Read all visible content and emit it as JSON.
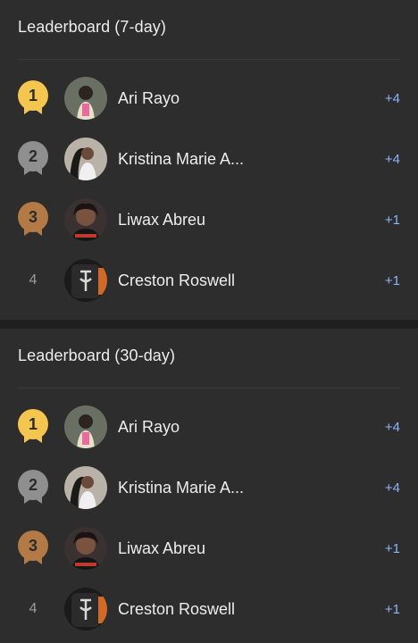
{
  "leaderboards": [
    {
      "title": "Leaderboard (7-day)",
      "entries": [
        {
          "rank": "1",
          "medal": "gold",
          "name": "Ari Rayo",
          "score": "+4"
        },
        {
          "rank": "2",
          "medal": "silver",
          "name": "Kristina Marie A...",
          "score": "+4"
        },
        {
          "rank": "3",
          "medal": "bronze",
          "name": "Liwax Abreu",
          "score": "+1"
        },
        {
          "rank": "4",
          "medal": "none",
          "name": "Creston Roswell",
          "score": "+1"
        }
      ]
    },
    {
      "title": "Leaderboard (30-day)",
      "entries": [
        {
          "rank": "1",
          "medal": "gold",
          "name": "Ari Rayo",
          "score": "+4"
        },
        {
          "rank": "2",
          "medal": "silver",
          "name": "Kristina Marie A...",
          "score": "+4"
        },
        {
          "rank": "3",
          "medal": "bronze",
          "name": "Liwax Abreu",
          "score": "+1"
        },
        {
          "rank": "4",
          "medal": "none",
          "name": "Creston Roswell",
          "score": "+1"
        }
      ]
    }
  ],
  "colors": {
    "gold": "#f4c64f",
    "silver": "#8f8f8f",
    "bronze": "#b37a45",
    "score": "#8ab4f8"
  },
  "icons": {
    "medal": "medal-ribbon-icon",
    "avatar": "user-avatar"
  }
}
